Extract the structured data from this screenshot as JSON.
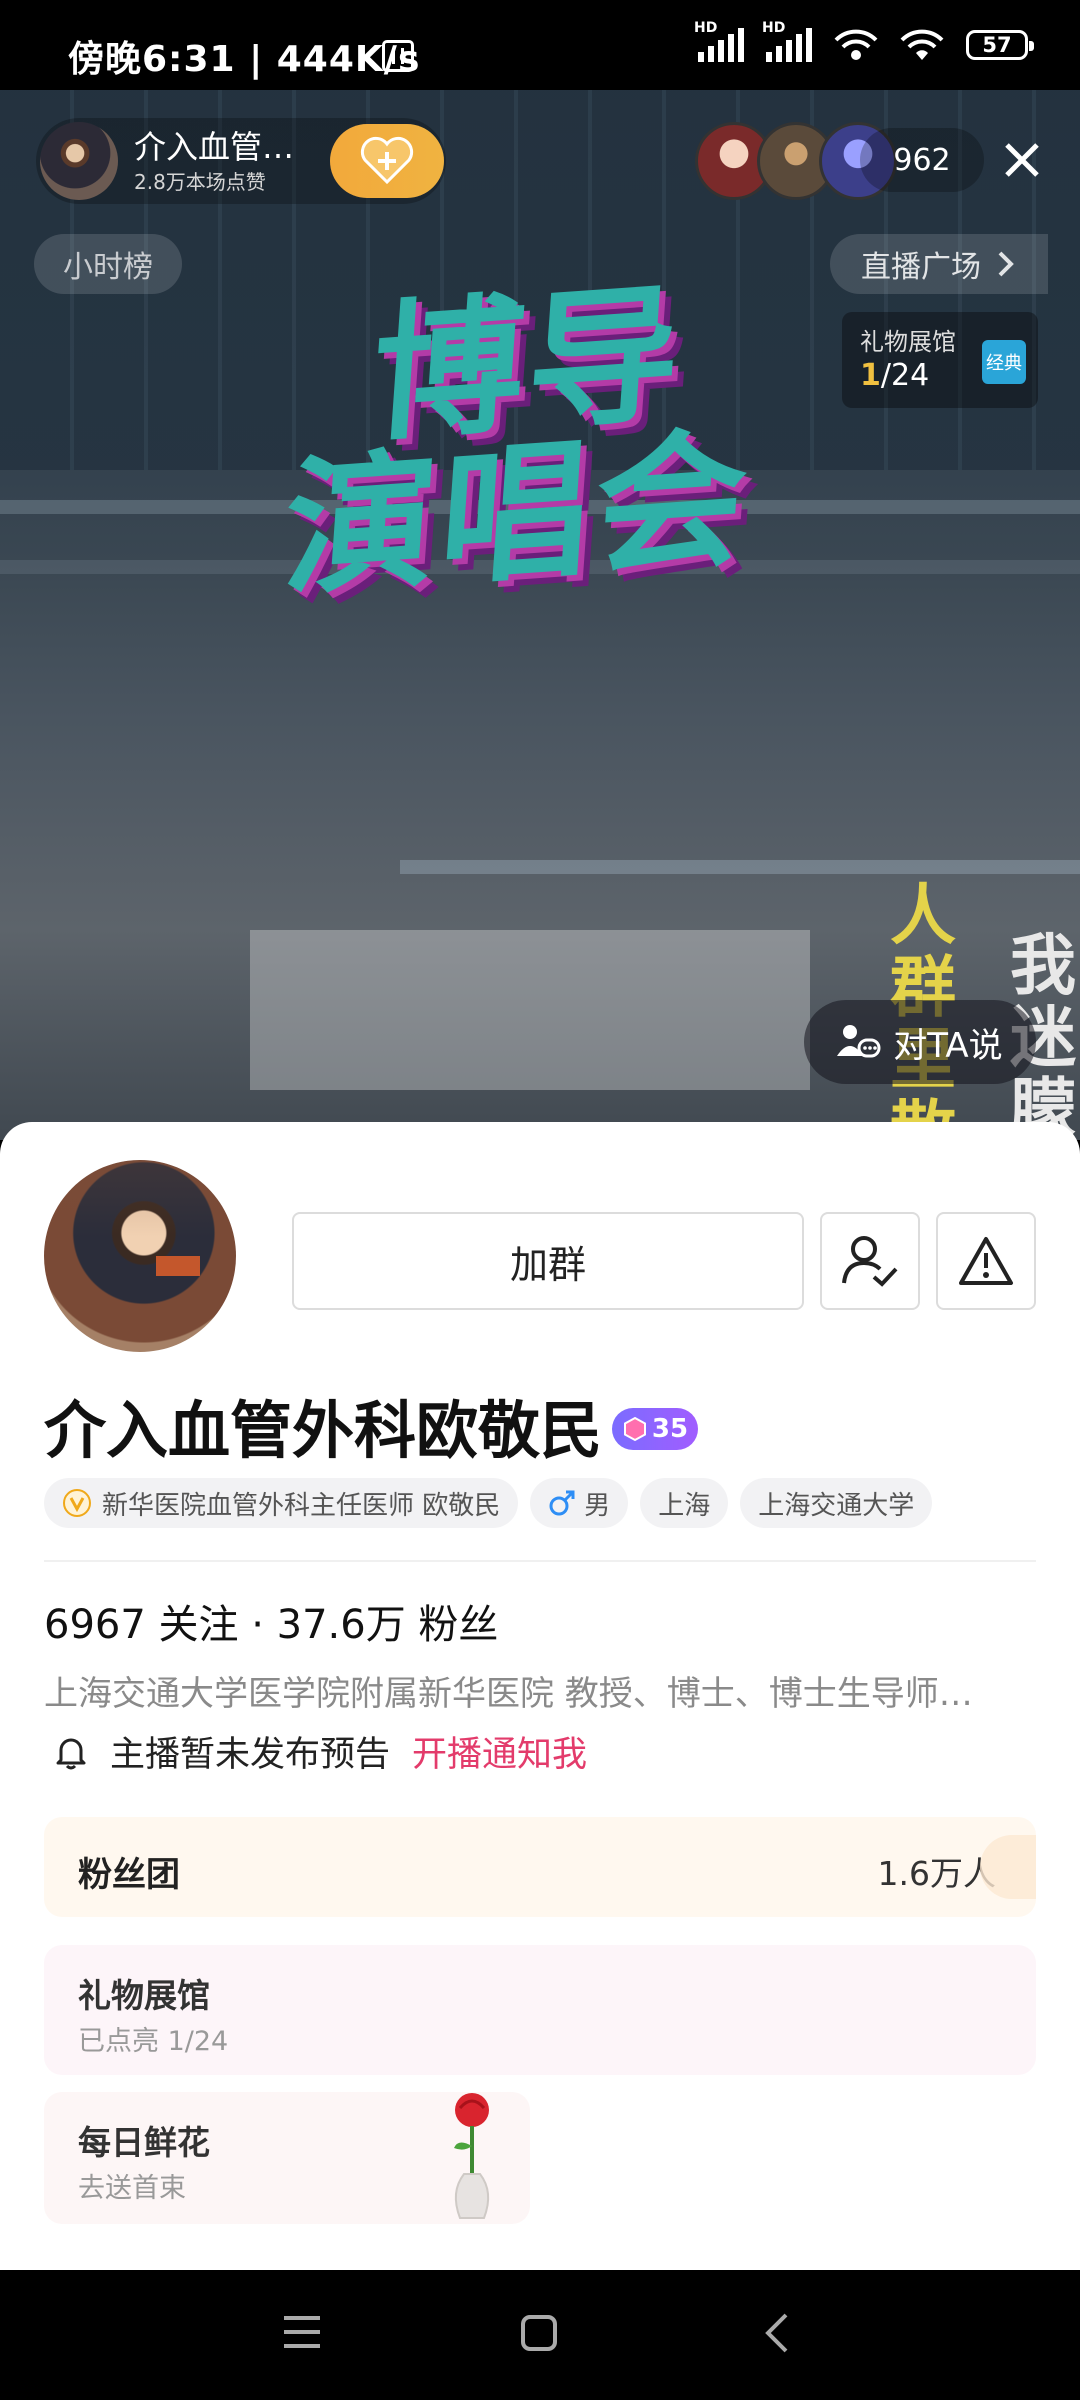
{
  "status_bar": {
    "time": "傍晚6:31 | 444K/s",
    "nfc_icon": "nfc-icon",
    "signal_label": "HD",
    "battery": "57"
  },
  "live": {
    "host_name": "介入血管…",
    "likes": "2.8万本场点赞",
    "viewer_count": "962",
    "hour_rank": "小时榜",
    "plaza": "直播广场",
    "gift_hall_title": "礼物展馆",
    "gift_hall_lit": "1",
    "gift_hall_total": "/24",
    "gift_hall_badge": "经典",
    "banner_line1": "博导",
    "banner_line2": "演唱会",
    "side_text_yellow": "人群里散",
    "side_text_white": "我迷朦的",
    "say_to_ta": "对TA说"
  },
  "profile": {
    "join_group": "加群",
    "name": "介入血管外科欧敬民",
    "level": "35",
    "verified_tag": "新华医院血管外科主任医师 欧敬民",
    "gender": "男",
    "city": "上海",
    "school": "上海交通大学",
    "stats": "6967 关注 · 37.6万 粉丝",
    "bio": "上海交通大学医学院附属新华医院 教授、博士、博士生导师…",
    "notice_text": "主播暂未发布预告",
    "notice_action": "开播通知我",
    "fan_club_title": "粉丝团",
    "fan_club_count": "1.6万人",
    "gift_hall_title": "礼物展馆",
    "gift_hall_sub": "已点亮 1/24",
    "flower_title": "每日鲜花",
    "flower_sub": "去送首束"
  },
  "colors": {
    "accent_pink": "#e33b6b",
    "follow_gold": "#f2a93b",
    "level_purple": "#8b64ff"
  }
}
